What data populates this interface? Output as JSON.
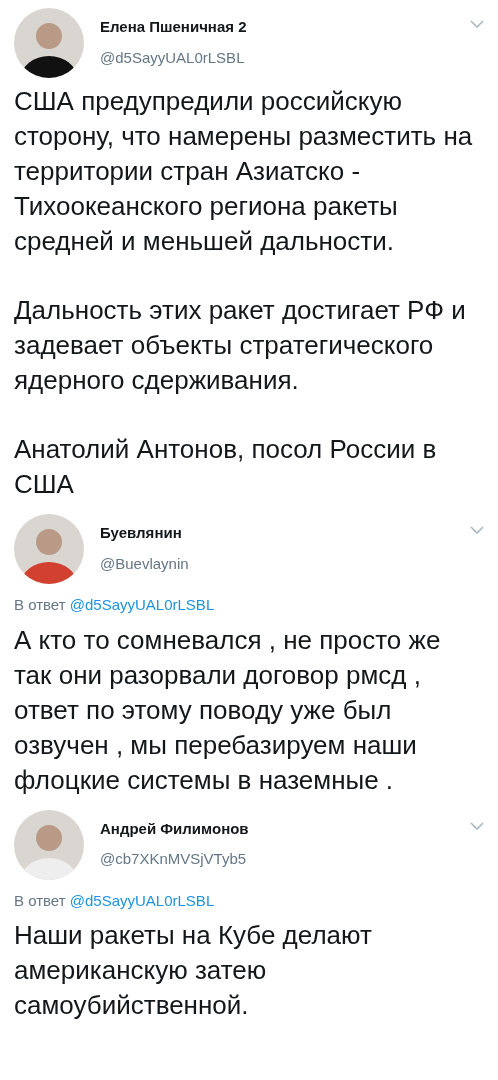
{
  "tweets": [
    {
      "name": "Елена Пшеничная 2",
      "handle": "@d5SayyUAL0rLSBL",
      "color": "#111111",
      "paragraphs": [
        "США предупредили российскую сторону, что намерены разместить на территории стран Азиатско - Тихоокеанского региона ракеты средней и меньшей дальности.",
        "Дальность этих ракет достигает РФ и задевает объекты стратегического ядерного сдерживания.",
        "Анатолий Антонов, посол России в США"
      ]
    },
    {
      "name": "Буевлянин",
      "handle": "@Buevlaynin",
      "color": "#d2412f",
      "reply_prefix": "В ответ",
      "reply_to": "@d5SayyUAL0rLSBL",
      "paragraphs": [
        "А кто то сомневался , не просто же так они разорвали договор рмсд , ответ по этому поводу уже был озвучен , мы перебазируем наши флоцкие системы в наземные ."
      ]
    },
    {
      "name": "Андрей Филимонов",
      "handle": "@cb7XKnMVSjVTyb5",
      "color": "#eeeeee",
      "reply_prefix": "В ответ",
      "reply_to": "@d5SayyUAL0rLSBL",
      "paragraphs": [
        "Наши ракеты на Кубе делают американскую затею самоубийственной."
      ]
    }
  ]
}
